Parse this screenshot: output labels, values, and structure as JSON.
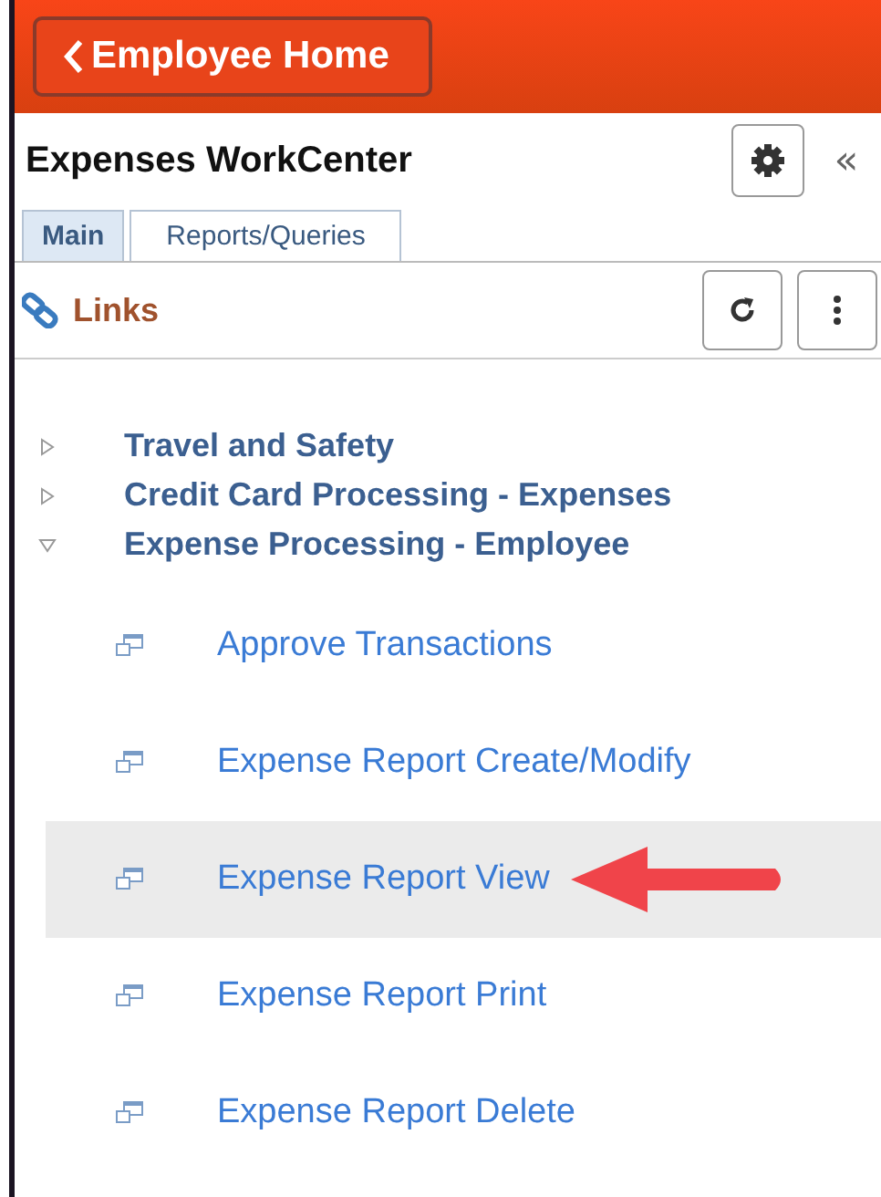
{
  "header": {
    "back_button": "Employee Home"
  },
  "title_bar": {
    "title": "Expenses WorkCenter",
    "collapse": "«"
  },
  "tabs": [
    {
      "label": "Main",
      "selected": true
    },
    {
      "label": "Reports/Queries",
      "selected": false
    }
  ],
  "section": {
    "title": "Links"
  },
  "folders": [
    {
      "label": "Travel and Safety",
      "expanded": false
    },
    {
      "label": "Credit Card Processing - Expenses",
      "expanded": false
    },
    {
      "label": "Expense Processing - Employee",
      "expanded": true,
      "children": [
        {
          "label": "Approve Transactions",
          "selected": false
        },
        {
          "label": "Expense Report Create/Modify",
          "selected": false
        },
        {
          "label": "Expense Report View",
          "selected": true
        },
        {
          "label": "Expense Report Print",
          "selected": false
        },
        {
          "label": "Expense Report Delete",
          "selected": false
        }
      ]
    }
  ]
}
